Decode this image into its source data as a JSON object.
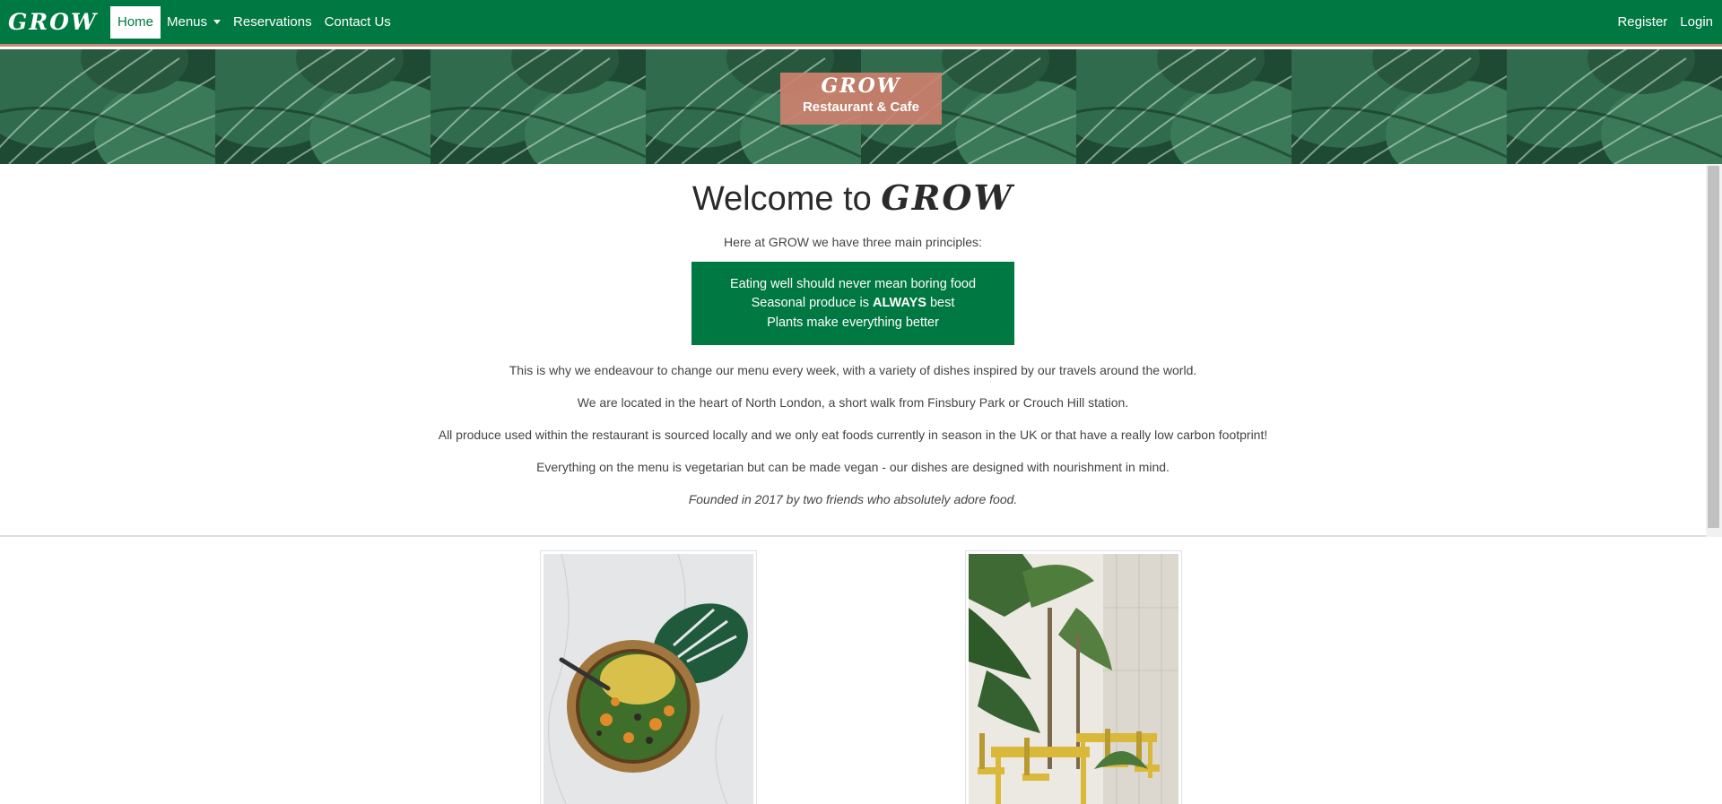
{
  "nav": {
    "brand": "GROW",
    "links": [
      {
        "label": "Home",
        "active": true
      },
      {
        "label": "Menus",
        "dropdown": true
      },
      {
        "label": "Reservations"
      },
      {
        "label": "Contact Us"
      }
    ],
    "right": [
      {
        "label": "Register"
      },
      {
        "label": "Login"
      }
    ]
  },
  "hero": {
    "title": "GROW",
    "subtitle": "Restaurant & Cafe"
  },
  "main": {
    "welcome_prefix": "Welcome to",
    "welcome_brand": "GROW",
    "intro": "Here at GROW we have three main principles:",
    "principles": {
      "line1": "Eating well should never mean boring food",
      "line2_pre": "Seasonal produce is",
      "line2_bold": "ALWAYS",
      "line2_post": "best",
      "line3": "Plants make everything better"
    },
    "paragraphs": [
      "This is why we endeavour to change our menu every week, with a variety of dishes inspired by our travels around the world.",
      "We are located in the heart of North London, a short walk from Finsbury Park or Crouch Hill station.",
      "All produce used within the restaurant is sourced locally and we only eat foods currently in season in the UK or that have a really low carbon footprint!",
      "Everything on the menu is vegetarian but can be made vegan - our dishes are designed with nourishment in mind."
    ],
    "founded": "Founded in 2017 by two friends who absolutely adore food."
  },
  "colors": {
    "brand_green": "#007841",
    "accent_rose": "#c98a7a"
  }
}
